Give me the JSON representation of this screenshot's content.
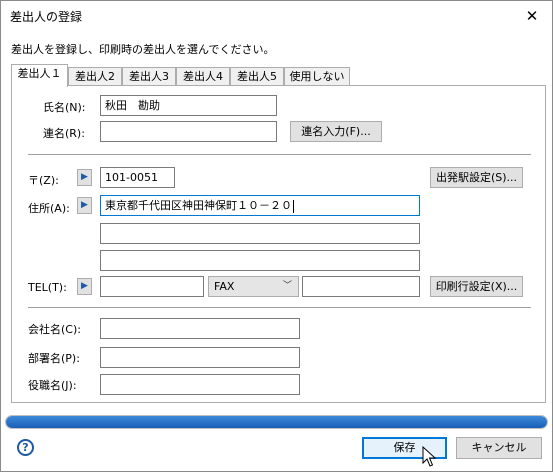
{
  "window": {
    "title": "差出人の登録",
    "close_glyph": "✕"
  },
  "instruction": "差出人を登録し、印刷時の差出人を選んでください。",
  "tabs": [
    {
      "label": "差出人１"
    },
    {
      "label": "差出人2"
    },
    {
      "label": "差出人3"
    },
    {
      "label": "差出人4"
    },
    {
      "label": "差出人5"
    },
    {
      "label": "使用しない"
    }
  ],
  "form": {
    "name_label": "氏名(N):",
    "name_value": "秋田　勘助",
    "joint_label": "連名(R):",
    "joint_value": "",
    "joint_button": "連名入力(F)...",
    "zip_label": "〒(Z):",
    "zip_value": "101-0051",
    "origin_button": "出発駅設定(S)...",
    "address_label": "住所(A):",
    "address_line1": "東京都千代田区神田神保町１０－２０",
    "address_line2": "",
    "address_line3": "",
    "tel_label": "TEL(T):",
    "tel_value": "",
    "fax_select": "FAX",
    "fax_value": "",
    "print_line_button": "印刷行設定(X)...",
    "company_label": "会社名(C):",
    "company_value": "",
    "dept_label": "部署名(P):",
    "dept_value": "",
    "title_label": "役職名(J):",
    "title_value": ""
  },
  "progress": {
    "fraction": 1.0
  },
  "footer": {
    "help_glyph": "?",
    "save_button": "保存",
    "cancel_button": "キャンセル"
  },
  "colors": {
    "accent": "#0078d7",
    "progress": "#1a5fb8"
  },
  "icons": {
    "arrow": "arrow-right-icon",
    "help": "help-icon",
    "chevron": "chevron-down-icon",
    "close": "close-icon",
    "cursor": "mouse-pointer-icon"
  }
}
